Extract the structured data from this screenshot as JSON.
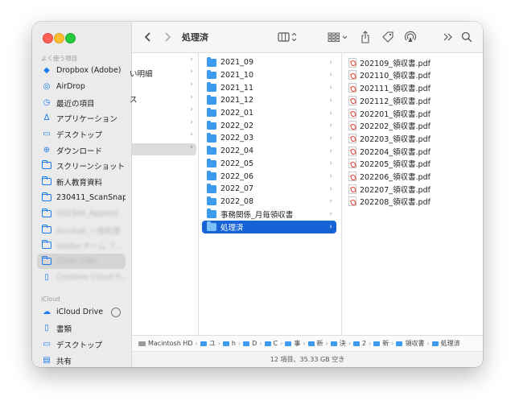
{
  "window": {
    "title": "処理済"
  },
  "sidebar": {
    "favorites_header": "よく使う項目",
    "favorites": [
      {
        "label": "Dropbox (Adobe)",
        "icon": "dropbox-icon"
      },
      {
        "label": "AirDrop",
        "icon": "airdrop-icon"
      },
      {
        "label": "最近の項目",
        "icon": "clock-icon"
      },
      {
        "label": "アプリケーション",
        "icon": "applications-icon"
      },
      {
        "label": "デスクトップ",
        "icon": "desktop-icon"
      },
      {
        "label": "ダウンロード",
        "icon": "download-icon"
      },
      {
        "label": "スクリーンショット",
        "icon": "folder-icon"
      },
      {
        "label": "新人教育資料",
        "icon": "folder-icon"
      },
      {
        "label": "230411_ScanSnap",
        "icon": "folder-icon"
      },
      {
        "label": "202304_AppleId",
        "icon": "folder-icon"
      },
      {
        "label": "Acrobat_一括処理",
        "icon": "folder-icon"
      },
      {
        "label": "Adobe チーム フ...",
        "icon": "folder-icon"
      },
      {
        "label": "Clean Clan",
        "icon": "folder-icon"
      },
      {
        "label": "Creative Cloud Fi...",
        "icon": "document-icon"
      }
    ],
    "icloud_header": "iCloud",
    "icloud": [
      {
        "label": "iCloud Drive",
        "icon": "cloud-icon"
      },
      {
        "label": "書類",
        "icon": "document-icon"
      },
      {
        "label": "デスクトップ",
        "icon": "desktop-icon"
      },
      {
        "label": "共有",
        "icon": "shared-icon"
      }
    ]
  },
  "column1": {
    "items": [
      "い明細",
      "ス"
    ]
  },
  "column2": {
    "items": [
      "2021_09",
      "2021_10",
      "2021_11",
      "2021_12",
      "2022_01",
      "2022_02",
      "2022_03",
      "2022_04",
      "2022_05",
      "2022_06",
      "2022_07",
      "2022_08",
      "事務関係_月毎領収書",
      "処理済"
    ],
    "selected_index": 13
  },
  "column3": {
    "items": [
      "202109_領収書.pdf",
      "202110_領収書.pdf",
      "202111_領収書.pdf",
      "202112_領収書.pdf",
      "202201_領収書.pdf",
      "202202_領収書.pdf",
      "202203_領収書.pdf",
      "202204_領収書.pdf",
      "202205_領収書.pdf",
      "202206_領収書.pdf",
      "202207_領収書.pdf",
      "202208_領収書.pdf"
    ]
  },
  "pathbar": {
    "segments": [
      "Macintosh HD",
      "ユ",
      "h",
      "D",
      "C",
      "事",
      "新",
      "決",
      "2",
      "新",
      "領収書",
      "処理済"
    ]
  },
  "status": "12 項目、35.33 GB 空き"
}
